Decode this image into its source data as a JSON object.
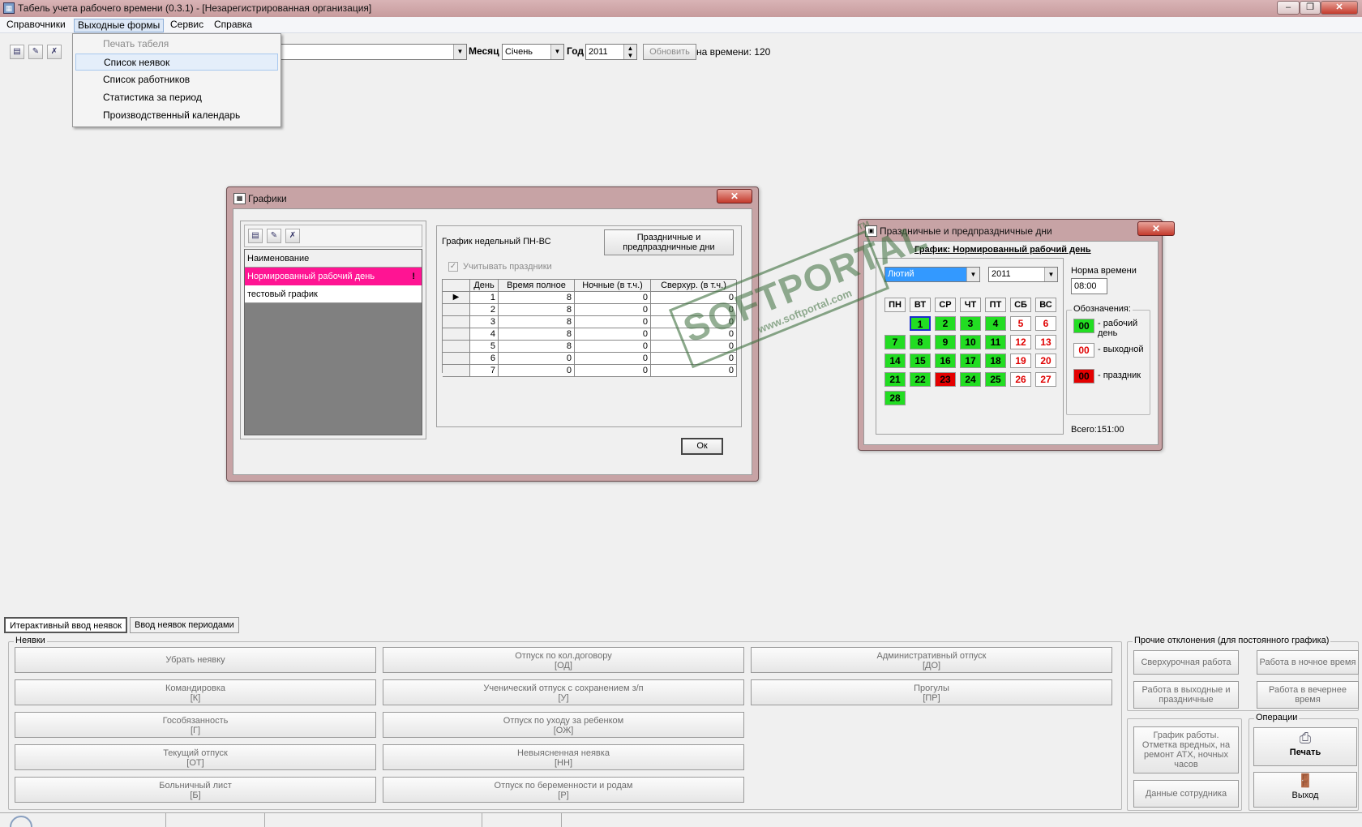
{
  "window": {
    "title": "Табель учета рабочего времени (0.3.1)  - [Незарегистрированная организация]"
  },
  "menubar": {
    "items": [
      "Справочники",
      "Выходные формы",
      "Сервис",
      "Справка"
    ]
  },
  "dropdown": {
    "items": [
      "Печать табеля",
      "Список неявок",
      "Список работников",
      "Статистика за период",
      "Производственный календарь"
    ]
  },
  "toolbar": {
    "month_label": "Месяц",
    "month_value": "Січень",
    "year_label": "Год",
    "year_value": "2011",
    "refresh_label": "Обновить",
    "norm_text": "на времени: 120"
  },
  "schedules_dialog": {
    "title": "Графики",
    "list_header": "Наименование",
    "list_items": [
      "Нормированный рабочий день",
      "тестовый график"
    ],
    "schedule_title": "График недельный ПН-ВС",
    "holidays_button": "Праздничные и\nпредпраздничные дни",
    "checkbox_label": "Учитывать праздники",
    "grid_headers": [
      "День",
      "Время полное",
      "Ночные (в т.ч.)",
      "Сверхур. (в т.ч.)"
    ],
    "grid_rows": [
      [
        "1",
        "8",
        "0",
        "0"
      ],
      [
        "2",
        "8",
        "0",
        "0"
      ],
      [
        "3",
        "8",
        "0",
        "0"
      ],
      [
        "4",
        "8",
        "0",
        "0"
      ],
      [
        "5",
        "8",
        "0",
        "0"
      ],
      [
        "6",
        "0",
        "0",
        "0"
      ],
      [
        "7",
        "0",
        "0",
        "0"
      ]
    ],
    "ok_label": "Ок"
  },
  "holidays_dialog": {
    "title": "Праздничные и предпраздничные дни",
    "subtitle": "График: Нормированный рабочий день",
    "month_value": "Лютий",
    "year_value": "2011",
    "norm_label": "Норма времени",
    "norm_value": "08:00",
    "legend_title": "Обозначения:",
    "legend": [
      {
        "code": "00",
        "text": "- рабочий\nдень"
      },
      {
        "code": "00",
        "text": "- выходной"
      },
      {
        "code": "00",
        "text": "- праздник"
      }
    ],
    "weekdays": [
      "ПН",
      "ВТ",
      "СР",
      "ЧТ",
      "ПТ",
      "СБ",
      "ВС"
    ],
    "days": [
      {
        "d": "1",
        "t": "work",
        "sel": true
      },
      {
        "d": "2",
        "t": "work"
      },
      {
        "d": "3",
        "t": "work"
      },
      {
        "d": "4",
        "t": "work"
      },
      {
        "d": "5",
        "t": "off"
      },
      {
        "d": "6",
        "t": "off"
      },
      {
        "d": "7",
        "t": "work"
      },
      {
        "d": "8",
        "t": "work"
      },
      {
        "d": "9",
        "t": "work"
      },
      {
        "d": "10",
        "t": "work"
      },
      {
        "d": "11",
        "t": "work"
      },
      {
        "d": "12",
        "t": "off"
      },
      {
        "d": "13",
        "t": "off"
      },
      {
        "d": "14",
        "t": "work"
      },
      {
        "d": "15",
        "t": "work"
      },
      {
        "d": "16",
        "t": "work"
      },
      {
        "d": "17",
        "t": "work"
      },
      {
        "d": "18",
        "t": "work"
      },
      {
        "d": "19",
        "t": "off"
      },
      {
        "d": "20",
        "t": "off"
      },
      {
        "d": "21",
        "t": "work"
      },
      {
        "d": "22",
        "t": "work"
      },
      {
        "d": "23",
        "t": "hol"
      },
      {
        "d": "24",
        "t": "work"
      },
      {
        "d": "25",
        "t": "work"
      },
      {
        "d": "26",
        "t": "off"
      },
      {
        "d": "27",
        "t": "off"
      },
      {
        "d": "28",
        "t": "work"
      }
    ],
    "total": "Всего:151:00"
  },
  "watermark": {
    "big": "SOFTPORTAL",
    "small": "www.softportal.com",
    "tm": "TM"
  },
  "tabs": [
    "Итерактивный ввод неявок",
    "Ввод неявок периодами"
  ],
  "absences": {
    "group_label": "Неявки",
    "buttons": [
      [
        "Убрать неявку",
        "",
        "Отпуск по кол.договору\n[ОД]",
        "Административный отпуск\n[ДО]"
      ],
      [
        "Командировка\n[К]",
        "Ученический отпуск с сохранением з/п\n[У]",
        "Прогулы\n[ПР]"
      ],
      [
        "Гособязанность\n[Г]",
        "Отпуск по уходу за ребенком\n[ОЖ]"
      ],
      [
        "Текущий отпуск\n[ОТ]",
        "Невыясненная неявка\n[НН]"
      ],
      [
        "Больничный лист\n[Б]",
        "Отпуск по беременности и родам\n[Р]"
      ]
    ]
  },
  "other": {
    "group_label": "Прочие отклонения (для постоянного графика)",
    "buttons": [
      "Сверхурочная работа",
      "Работа в ночное время",
      "Работа в выходные и\nпраздничные",
      "Работа в вечернее\nвремя"
    ]
  },
  "side": {
    "schedule_button": "График работы.\nОтметка вредных, на\nремонт АТХ, ночных\nчасов",
    "employee_button": "Данные сотрудника"
  },
  "operations": {
    "group_label": "Операции",
    "print_label": "Печать",
    "exit_label": "Выход"
  }
}
